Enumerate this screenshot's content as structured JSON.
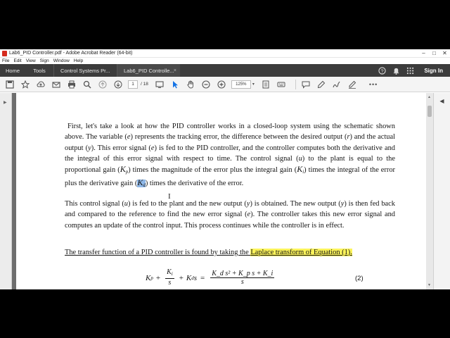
{
  "window": {
    "title": "Lab6_PID Controller.pdf - Adobe Acrobat Reader (64-bit)",
    "controls": {
      "minimize": "–",
      "maximize": "□",
      "close": "✕"
    }
  },
  "menu": [
    "File",
    "Edit",
    "View",
    "Sign",
    "Window",
    "Help"
  ],
  "tabs": {
    "home": "Home",
    "tools": "Tools",
    "docs": [
      {
        "label": "Control Systems Pr...",
        "close": ""
      },
      {
        "label": "Lab6_PID Controlle...",
        "close": "×"
      }
    ],
    "sign_in": "Sign In"
  },
  "toolbar": {
    "page_current": "1",
    "page_total": "/ 18",
    "zoom": "125%",
    "zoom_caret": "▾",
    "more": "•••"
  },
  "document": {
    "p1_a": "First, let's take a look at how the PID controller works in a closed-loop system using the schematic shown above. The variable (",
    "p1_e1": "e",
    "p1_b": ") represents the tracking error, the difference between the desired output (",
    "p1_r": "r",
    "p1_c": ") and the actual output (",
    "p1_y": "y",
    "p1_d": "). This error signal (",
    "p1_e2": "e",
    "p1_e": ") is fed to the PID controller, and the controller computes both the derivative and the integral of this error signal with respect to time. The control signal (",
    "p1_u": "u",
    "p1_f": ") to the plant is equal to the proportional gain (",
    "p1_kp": "K",
    "p1_kp_sub": "p",
    "p1_g": ") times the magnitude of the error plus the integral gain (",
    "p1_ki": "K",
    "p1_ki_sub": "i",
    "p1_h": ") times the integral of the error plus the derivative gain (",
    "p1_kd": "K",
    "p1_kd_sub": "d",
    "p1_i": ") times the derivative of the error.",
    "p2_a": "This control signal (",
    "p2_u": "u",
    "p2_b": ") is fed to the plant and the new output (",
    "p2_y1": "y",
    "p2_c": ") is obtained. The new output (",
    "p2_y2": "y",
    "p2_d": ") is then fed back and compared to the reference to find the new error signal (",
    "p2_e": "e",
    "p2_f": "). The controller takes this new error signal and computes an update of the control input. This process continues while the controller is in effect.",
    "p3_a": "The transfer function of a PID controller is found by taking the ",
    "p3_b": "Laplace transform of Equation (1).",
    "equation": {
      "kp": "K",
      "kp_sub": "p",
      "plus1": "+",
      "frac1_num": "K",
      "frac1_num_sub": "i",
      "frac1_den": "s",
      "plus2": "+",
      "kd": "K",
      "kd_sub": "d",
      "kd_s": "s",
      "equals": "=",
      "frac2_num": "K_d s² + K_p s + K_i",
      "frac2_den": "s",
      "number": "(2)"
    }
  },
  "colors": {
    "tabbar": "#3c3c3c",
    "highlight_yellow": "#fbf35a",
    "highlight_blue": "#8fb8e8",
    "accent": "#1473e6"
  }
}
